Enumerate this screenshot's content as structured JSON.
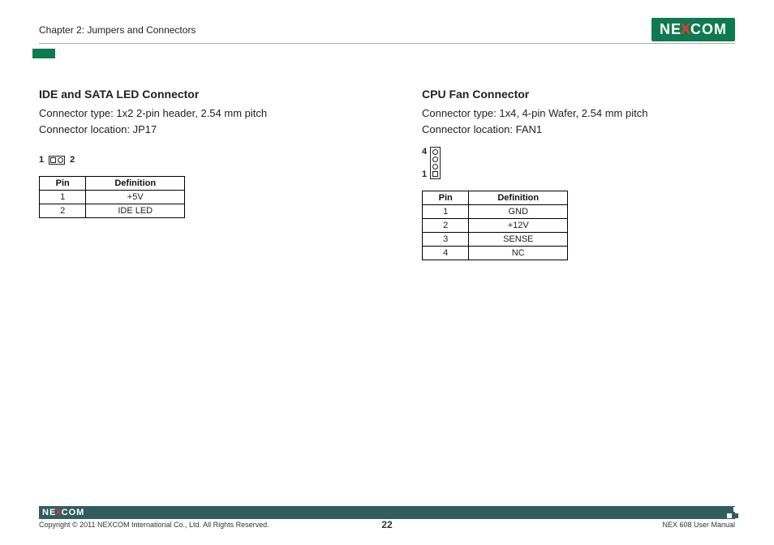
{
  "header": {
    "chapter": "Chapter 2: Jumpers and Connectors",
    "logo_pre": "NE",
    "logo_x": "X",
    "logo_post": "COM"
  },
  "left": {
    "title": "IDE and SATA LED Connector",
    "type_line": "Connector type: 1x2 2-pin header, 2.54 mm pitch",
    "loc_line": "Connector location: JP17",
    "pin_left": "1",
    "pin_right": "2",
    "table": {
      "headers": {
        "pin": "Pin",
        "def": "Definition"
      },
      "rows": [
        {
          "pin": "1",
          "def": "+5V"
        },
        {
          "pin": "2",
          "def": "IDE LED"
        }
      ]
    }
  },
  "right": {
    "title": "CPU Fan Connector",
    "type_line": "Connector type: 1x4, 4-pin Wafer, 2.54 mm pitch",
    "loc_line": "Connector location: FAN1",
    "pin_top": "4",
    "pin_bottom": "1",
    "table": {
      "headers": {
        "pin": "Pin",
        "def": "Definition"
      },
      "rows": [
        {
          "pin": "1",
          "def": "GND"
        },
        {
          "pin": "2",
          "def": "+12V"
        },
        {
          "pin": "3",
          "def": "SENSE"
        },
        {
          "pin": "4",
          "def": "NC"
        }
      ]
    }
  },
  "footer": {
    "logo_pre": "NE",
    "logo_x": "X",
    "logo_post": "COM",
    "copyright": "Copyright © 2011 NEXCOM International Co., Ltd. All Rights Reserved.",
    "page": "22",
    "doc": "NEX 608 User Manual"
  }
}
